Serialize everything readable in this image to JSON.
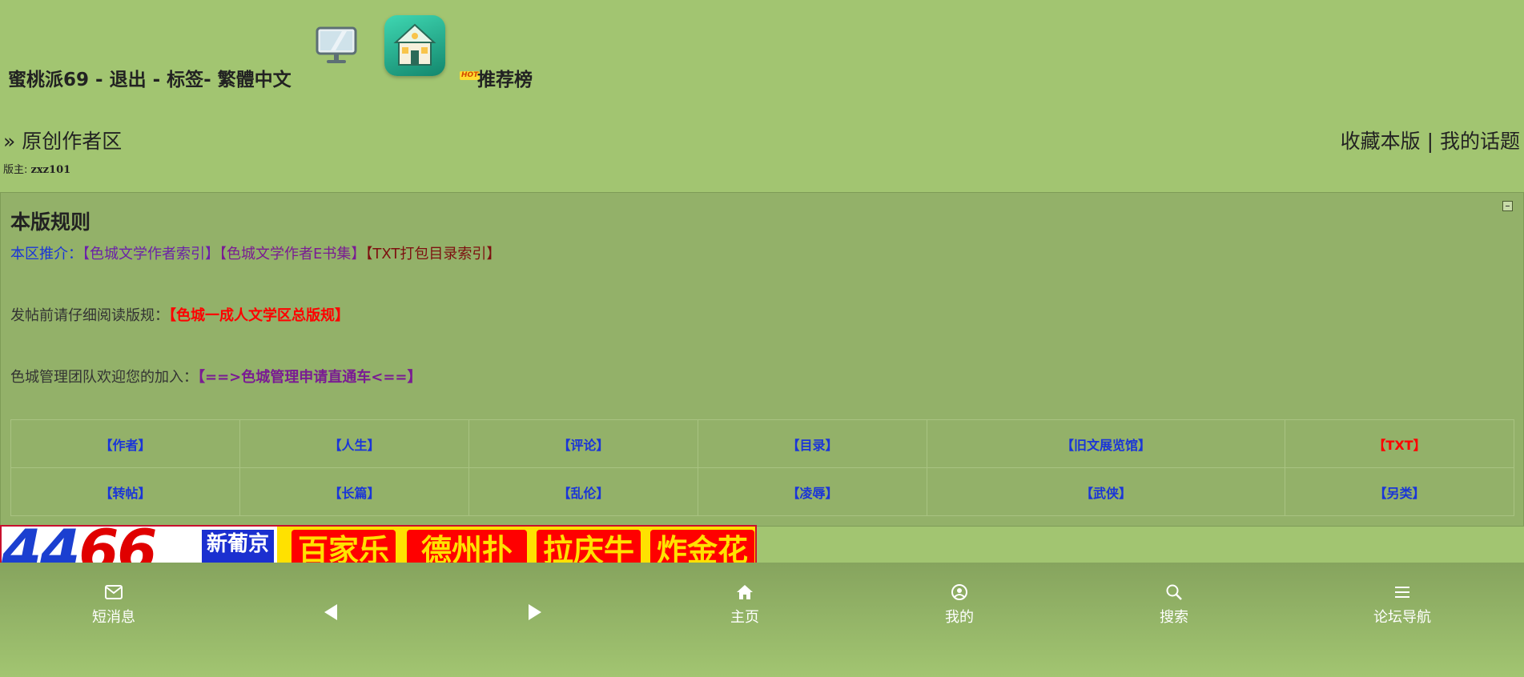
{
  "header": {
    "site_title": "蜜桃派69 - 退出 - 标签- 繁體中文",
    "hot_badge": "HOT",
    "rank_label": "推荐榜",
    "monitor_icon": "monitor-icon",
    "app_icon": "house-app-icon"
  },
  "forum": {
    "breadcrumb": "» 原创作者区",
    "favorite_label": "收藏本版",
    "separator": "|",
    "my_topics_label": "我的话题",
    "moderator_label": "版主: ",
    "moderator_name": "zxz101"
  },
  "rules": {
    "title": "本版规则",
    "recommend_prefix": "本区推介：",
    "recommend_links": [
      "【色城文学作者索引】",
      "【色城文学作者E书集】",
      "【TXT打包目录索引】"
    ],
    "read_prefix": "发帖前请仔细阅读版规：",
    "read_link": "【色城一成人文学区总版规】",
    "join_prefix": "色城管理团队欢迎您的加入：",
    "join_link": "【==>色城管理申请直通车<==】"
  },
  "categories": {
    "row1": [
      "【作者】",
      "【人生】",
      "【评论】",
      "【目录】",
      "【旧文展览馆】",
      "【TXT】"
    ],
    "row2": [
      "【转帖】",
      "【长篇】",
      "【乱伦】",
      "【凌辱】",
      "【武侠】",
      "【另类】"
    ]
  },
  "banner": {
    "number_a": "44",
    "number_b": "66",
    "brand": "新葡京",
    "tiles": [
      "百家乐",
      "德州扑克",
      "拉庆牛牛",
      "炸金花"
    ]
  },
  "bottom_nav": {
    "messages": "短消息",
    "home": "主页",
    "mine": "我的",
    "search": "搜索",
    "forum_nav": "论坛导航"
  },
  "colors": {
    "page_bg": "#a2c571",
    "rules_bg": "#93b169",
    "link_blue": "#1a35d8",
    "link_red": "#ff0000",
    "link_purple": "#6b21a8"
  }
}
